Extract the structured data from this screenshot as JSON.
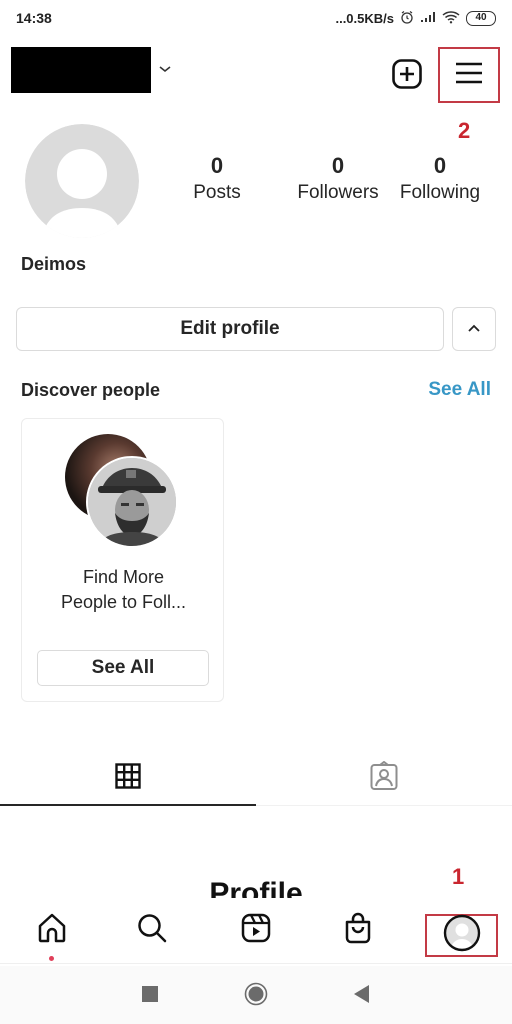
{
  "status_bar": {
    "time": "14:38",
    "network_speed": "...0.5KB/s",
    "battery": "40",
    "icons": [
      "alarm-icon",
      "signal-icon",
      "wifi-icon",
      "battery-icon"
    ]
  },
  "header": {
    "username": "",
    "username_redacted": true,
    "icons": [
      "chevron-down-icon",
      "add-post-icon",
      "hamburger-menu-icon"
    ]
  },
  "annotations": {
    "menu_marker": "2",
    "profile_tab_marker": "1",
    "highlight_color": "#c33a45",
    "marker_color": "#c9262f"
  },
  "profile": {
    "display_name": "Deimos",
    "stats": [
      {
        "value": "0",
        "label": "Posts"
      },
      {
        "value": "0",
        "label": "Followers"
      },
      {
        "value": "0",
        "label": "Following"
      }
    ],
    "edit_profile_label": "Edit profile"
  },
  "discover": {
    "title": "Discover people",
    "see_all_label": "See All",
    "link_color": "#3897c6",
    "card": {
      "text_line1": "Find More",
      "text_line2": "People to Foll...",
      "button_label": "See All"
    }
  },
  "tabs": [
    {
      "name": "posts-grid",
      "icon": "grid-icon",
      "active": true
    },
    {
      "name": "tagged",
      "icon": "tagged-person-icon",
      "active": false
    }
  ],
  "empty_state": {
    "heading": "Profile"
  },
  "bottom_nav": [
    {
      "name": "home",
      "icon": "home-icon",
      "has_notification_dot": true
    },
    {
      "name": "search",
      "icon": "search-icon"
    },
    {
      "name": "reels",
      "icon": "reels-icon"
    },
    {
      "name": "shop",
      "icon": "shop-bag-icon"
    },
    {
      "name": "profile",
      "icon": "profile-avatar-icon",
      "active": true
    }
  ],
  "system_nav": [
    "recent-apps",
    "home",
    "back"
  ]
}
